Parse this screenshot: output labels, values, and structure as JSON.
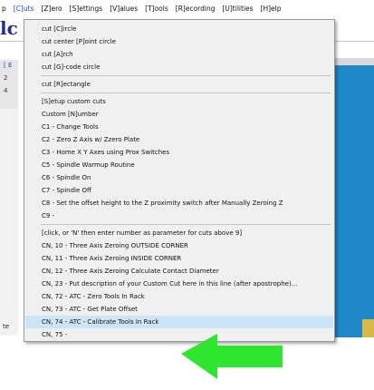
{
  "menubar": {
    "items": [
      {
        "label": "[C]uts",
        "active": true
      },
      {
        "label": "[Z]ero",
        "active": false
      },
      {
        "label": "[S]ettings",
        "active": false
      },
      {
        "label": "[V]alues",
        "active": false
      },
      {
        "label": "[T]ools",
        "active": false
      },
      {
        "label": "[R]ecording",
        "active": false
      },
      {
        "label": "[U]tilities",
        "active": false
      },
      {
        "label": "[H]elp",
        "active": false
      }
    ],
    "partial_left": "p"
  },
  "background": {
    "logo_fragment": "lc",
    "left_paren": "[ E",
    "left_numbers": [
      "2",
      "4"
    ],
    "left_label": "te"
  },
  "cuts_menu": {
    "items": [
      {
        "label": "cut [C]ircle"
      },
      {
        "label": "cut center [P]oint circle"
      },
      {
        "label": "cut [A]rch"
      },
      {
        "label": "cut [G]-code circle"
      },
      {
        "separator": true
      },
      {
        "label": "cut [R]ectangle"
      },
      {
        "separator": true
      },
      {
        "label": "[S]etup custom cuts"
      },
      {
        "label": "Custom [N]umber"
      },
      {
        "label": "C1  -  Change Tools"
      },
      {
        "label": "C2  -  Zero Z Axis w/ Zzero Plate"
      },
      {
        "label": "C3  -  Home X  Y Axes using Prox Switches"
      },
      {
        "label": "C5  -  Spindle Warmup Routine"
      },
      {
        "label": "C6  -  Spindle On"
      },
      {
        "label": "C7  -  Spindle Off"
      },
      {
        "label": "C8  -  Set the offset height to the Z proximity switch after Manually Zeroing Z"
      },
      {
        "label": "C9  -"
      },
      {
        "separator": true
      },
      {
        "label": "[click, or 'N' then enter number as parameter for cuts above 9]"
      },
      {
        "label": "CN, 10  -  Three Axis Zeroing OUTSIDE CORNER"
      },
      {
        "label": "CN, 11  -  Three Axis Zeroing INSIDE CORNER"
      },
      {
        "label": "CN, 12  -  Three Axis Zeroing Calculate Contact Diameter"
      },
      {
        "label": "CN, 23  -  Put description of your Custom Cut here in this line (after apostrophe)..."
      },
      {
        "label": "CN, 72  -  ATC - Zero Tools In Rack"
      },
      {
        "label": "CN, 73  -  ATC - Get Plate Offset"
      },
      {
        "label": "CN, 74  -  ATC - Calibrate Tools In Rack",
        "highlighted": true
      },
      {
        "label": "CN, 75  -"
      }
    ]
  },
  "colors": {
    "arrow": "#2ee62e",
    "highlight": "#cce4f7",
    "menu_bg": "#f0f0f0",
    "accent_blue": "#1a47b8",
    "side_panel_blue": "#1e88c9"
  },
  "icons": {
    "pointer": "green-arrow-icon"
  }
}
